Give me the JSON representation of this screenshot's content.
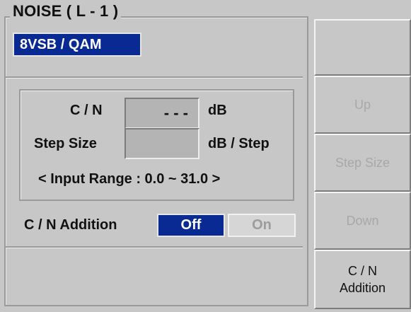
{
  "panel": {
    "title": "NOISE ( L - 1 )",
    "mode_badge": "8VSB / QAM"
  },
  "cn": {
    "label": "C / N",
    "value": "- - -",
    "unit": "dB"
  },
  "step_size": {
    "label": "Step Size",
    "value": "",
    "unit": "dB / Step"
  },
  "input_range": "< Input Range : 0.0 ~ 31.0 >",
  "cn_addition": {
    "label": "C / N Addition",
    "off_label": "Off",
    "on_label": "On",
    "selected": "Off"
  },
  "softkeys": {
    "blank": "",
    "up": "Up",
    "step_size": "Step Size",
    "down": "Down",
    "cn_addition_line1": "C / N",
    "cn_addition_line2": "Addition"
  },
  "colors": {
    "background": "#c7c7c7",
    "selected_blue": "#0a2a93",
    "disabled_text": "#a8a8a8"
  }
}
